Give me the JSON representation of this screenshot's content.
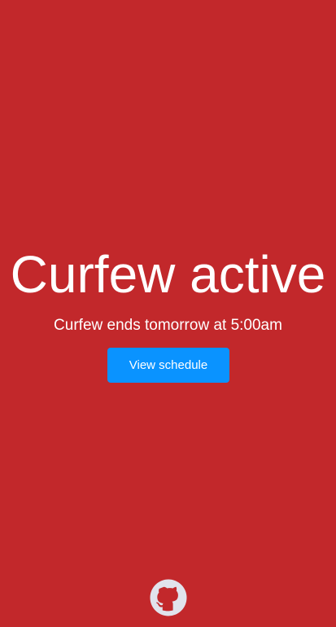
{
  "status": {
    "title": "Curfew active",
    "subtitle": "Curfew ends tomorrow at 5:00am"
  },
  "actions": {
    "view_schedule_label": "View schedule"
  },
  "footer": {
    "icon": "github-icon"
  },
  "colors": {
    "background": "#c2282b",
    "button": "#0a93ff",
    "text": "#ffffff",
    "icon": "#e1e3ec"
  }
}
